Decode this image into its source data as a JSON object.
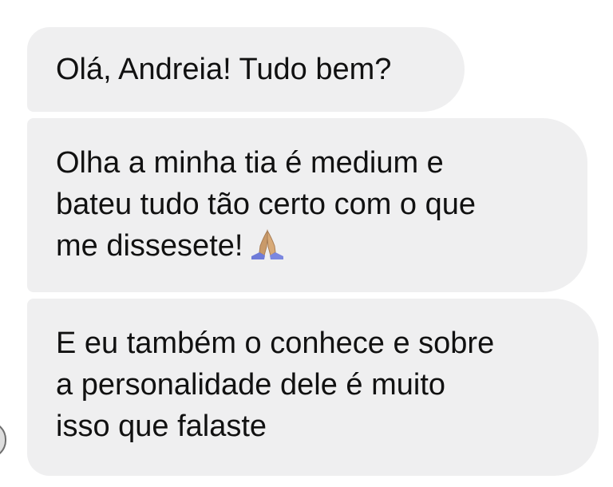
{
  "messages": [
    {
      "lines": [
        "Olá, Andreia! Tudo bem?"
      ]
    },
    {
      "lines": [
        "Olha a minha tia é medium e",
        "bateu tudo tão certo com o que",
        "me dissesete!"
      ],
      "emoji": "folded-hands"
    },
    {
      "lines": [
        "E eu também o conhece e sobre",
        "a personalidade dele é muito",
        "isso que falaste"
      ]
    }
  ],
  "colors": {
    "bubble_background": "#efeff0",
    "text": "#111111",
    "emoji_skin": "#c99a6a",
    "emoji_sleeve": "#6f7bd8"
  }
}
